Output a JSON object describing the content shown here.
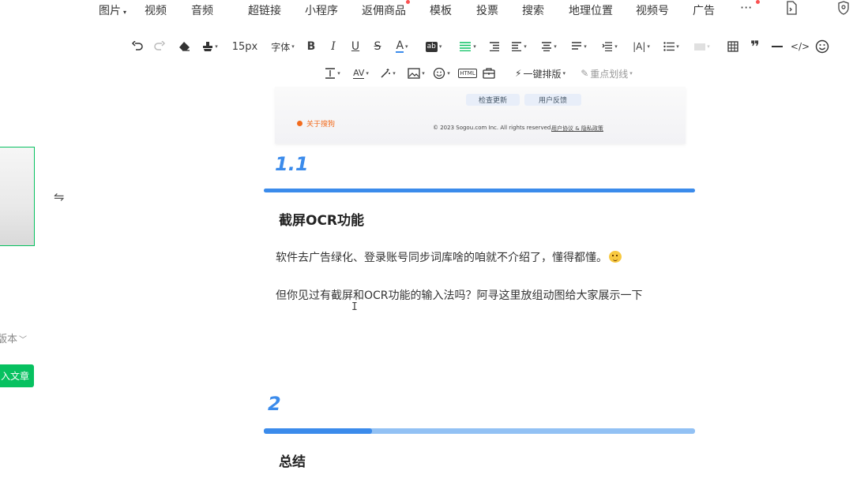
{
  "top_menu": {
    "items": [
      "图片",
      "视频",
      "音频",
      "超链接",
      "小程序",
      "返佣商品",
      "模板",
      "投票",
      "搜索",
      "地理位置",
      "视频号",
      "广告",
      "···"
    ],
    "badge_color": "#fa5151"
  },
  "toolbar": {
    "font_size": "15px",
    "font_family": "字体",
    "one_key_layout": "一键排版",
    "highlight_line": "重点划线",
    "html_label": "HTML"
  },
  "left_panel": {
    "version_label": "版本",
    "insert_button": "入文章",
    "accent_color": "#07c160"
  },
  "embedded_image": {
    "check_update": "检查更新",
    "feedback": "用户反馈",
    "about": "关于搜狗",
    "copyright": "© 2023 Sogou.com Inc. All rights reserved.",
    "links": "用户协议 & 隐私政策"
  },
  "article": {
    "accent_color": "#3b8beb",
    "section_1_1": {
      "number": "1.1",
      "progress": 1.0,
      "heading": "截屏OCR功能",
      "para1": "软件去广告绿化、登录账号同步词库啥的咱就不介绍了，懂得都懂。",
      "para2": "但你见过有截屏和OCR功能的输入法吗？阿寻这里放组动图给大家展示一下"
    },
    "section_2": {
      "number": "2",
      "progress": 0.25,
      "heading": "总结"
    }
  }
}
